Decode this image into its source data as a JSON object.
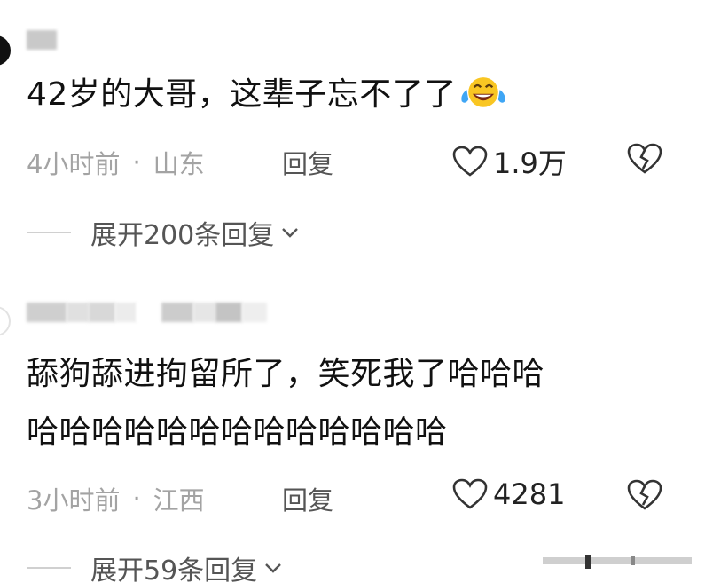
{
  "comments": [
    {
      "text": "42岁的大哥，这辈子忘不了了",
      "emoji": "laughing-crying-emoji",
      "time": "4小时前",
      "location": "山东",
      "reply_label": "回复",
      "likes": "1.9万",
      "expand_label": "展开200条回复"
    },
    {
      "text_line1": "舔狗舔进拘留所了，笑死我了哈哈哈",
      "text_line2": "哈哈哈哈哈哈哈哈哈哈哈哈哈",
      "time": "3小时前",
      "location": "江西",
      "reply_label": "回复",
      "likes": "4281",
      "expand_label": "展开59条回复"
    }
  ],
  "separator": "·",
  "colors": {
    "meta": "#a3a3a3",
    "text": "#111111",
    "reply": "#555555"
  }
}
